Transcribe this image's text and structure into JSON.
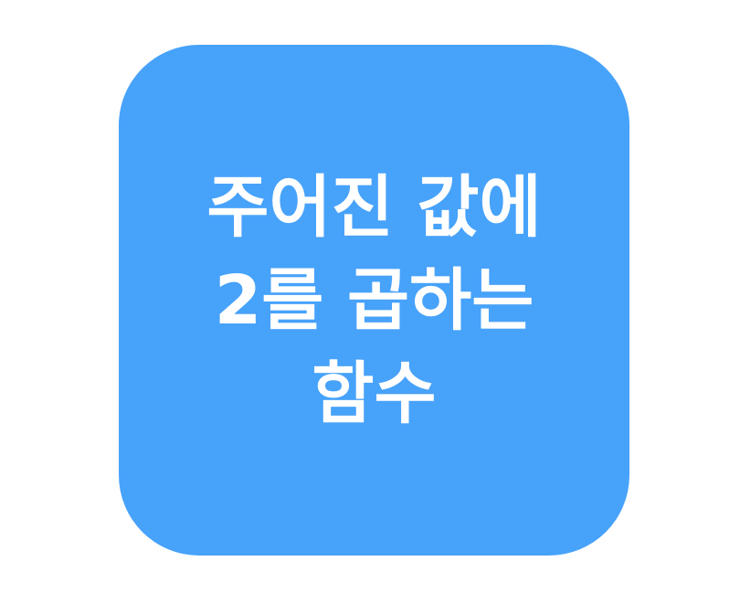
{
  "block": {
    "color": "#47a2fa",
    "text_color": "#ffffff",
    "lines": [
      "주어진 값에",
      "2를 곱하는",
      "함수"
    ]
  }
}
